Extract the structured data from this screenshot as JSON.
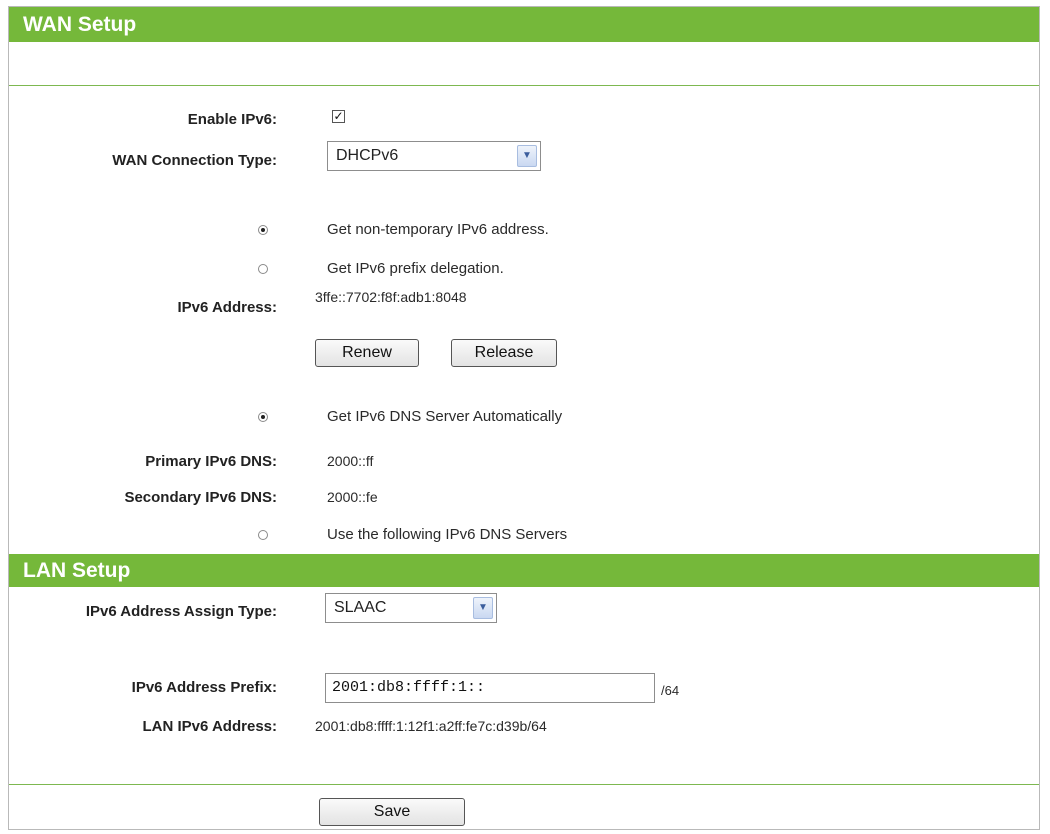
{
  "wan": {
    "header": "WAN Setup",
    "enable_ipv6_label": "Enable IPv6:",
    "enable_ipv6_checked": true,
    "connection_type_label": "WAN Connection Type:",
    "connection_type_value": "DHCPv6",
    "option_non_temporary": "Get non-temporary IPv6 address.",
    "option_prefix_delegation": "Get IPv6 prefix delegation.",
    "ipv6_address_label": "IPv6 Address:",
    "ipv6_address_value": "3ffe::7702:f8f:adb1:8048",
    "renew_label": "Renew",
    "release_label": "Release",
    "dns_auto_label": "Get IPv6 DNS Server Automatically",
    "primary_dns_label": "Primary IPv6 DNS:",
    "primary_dns_value": "2000::ff",
    "secondary_dns_label": "Secondary IPv6 DNS:",
    "secondary_dns_value": "2000::fe",
    "dns_manual_label": "Use the following IPv6 DNS Servers"
  },
  "lan": {
    "header": "LAN Setup",
    "assign_type_label": "IPv6 Address Assign Type:",
    "assign_type_value": "SLAAC",
    "prefix_label": "IPv6 Address Prefix:",
    "prefix_value": "2001:db8:ffff:1::",
    "prefix_suffix": "/64",
    "lan_address_label": "LAN IPv6 Address:",
    "lan_address_value": "2001:db8:ffff:1:12f1:a2ff:fe7c:d39b/64"
  },
  "footer": {
    "save_label": "Save"
  },
  "colors": {
    "header_green": "#75b83a",
    "divider_green": "#7db850"
  },
  "icons": {
    "checkbox": "checkmark-icon",
    "dropdown": "chevron-down-icon"
  }
}
